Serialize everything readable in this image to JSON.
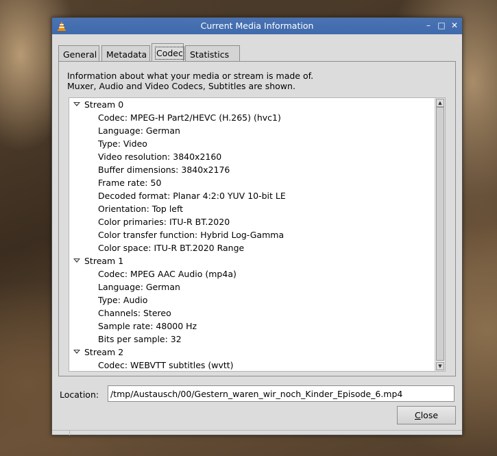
{
  "window": {
    "title": "Current Media Information",
    "icon": "vlc-cone-icon",
    "controls": {
      "minimize": "–",
      "maximize": "□",
      "close": "✕"
    }
  },
  "tabs": [
    {
      "label": "General",
      "selected": false
    },
    {
      "label": "Metadata",
      "selected": false
    },
    {
      "label": "Codec",
      "selected": true
    },
    {
      "label": "Statistics",
      "selected": false
    }
  ],
  "codec": {
    "description_line1": "Information about what your media or stream is made of.",
    "description_line2": "Muxer, Audio and Video Codecs, Subtitles are shown.",
    "streams": [
      {
        "label": "Stream 0",
        "items": [
          "Codec: MPEG-H Part2/HEVC (H.265) (hvc1)",
          "Language: German",
          "Type: Video",
          "Video resolution: 3840x2160",
          "Buffer dimensions: 3840x2176",
          "Frame rate: 50",
          "Decoded format: Planar 4:2:0 YUV 10-bit LE",
          "Orientation: Top left",
          "Color primaries: ITU-R BT.2020",
          "Color transfer function: Hybrid Log-Gamma",
          "Color space: ITU-R BT.2020 Range"
        ]
      },
      {
        "label": "Stream 1",
        "items": [
          "Codec: MPEG AAC Audio (mp4a)",
          "Language: German",
          "Type: Audio",
          "Channels: Stereo",
          "Sample rate: 48000 Hz",
          "Bits per sample: 32"
        ]
      },
      {
        "label": "Stream 2",
        "items": [
          "Codec: WEBVTT subtitles (wvtt)"
        ]
      }
    ]
  },
  "location": {
    "label": "Location:",
    "value": "/tmp/Austausch/00/Gestern_waren_wir_noch_Kinder_Episode_6.mp4"
  },
  "buttons": {
    "close_first": "C",
    "close_rest": "lose"
  },
  "colors": {
    "titlebar": "#4a73b4",
    "window_bg": "#dcdcdc"
  }
}
